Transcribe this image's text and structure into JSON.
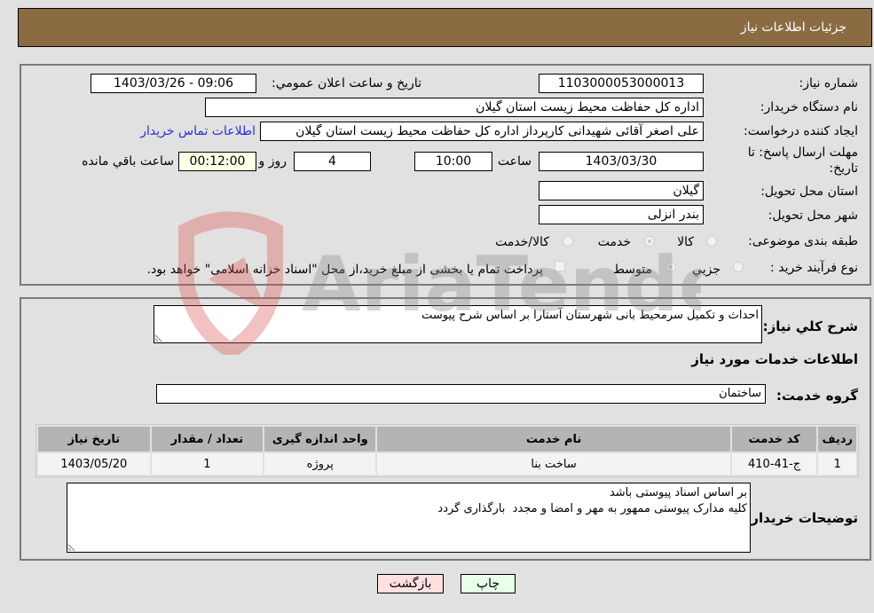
{
  "header": {
    "title": "جزئیات اطلاعات نیاز"
  },
  "details": {
    "need_number_label": "شماره نیاز:",
    "need_number": "1103000053000013",
    "announce_label": "تاريخ و ساعت اعلان عمومي:",
    "announce_value": "1403/03/26 - 09:06",
    "buyer_org_label": "نام دستگاه خریدار:",
    "buyer_org": "اداره کل حفاظت محیط زیست استان گیلان",
    "creator_label": "ایجاد کننده درخواست:",
    "creator": "علی اصغر آقائی شهیدانی کارپرداز اداره کل حفاظت محیط زیست استان گیلان",
    "contact_link": "اطلاعات تماس خریدار",
    "deadline_label_line1": "مهلت ارسال پاسخ: تا",
    "deadline_label_line2": "تاریخ:",
    "deadline_date": "1403/03/30",
    "time_label": "ساعت",
    "deadline_time": "10:00",
    "days_value": "4",
    "days_label": "روز و",
    "remaining_time": "00:12:00",
    "remaining_label": "ساعت باقي مانده",
    "province_label": "استان محل تحویل:",
    "province": "گیلان",
    "city_label": "شهر محل تحویل:",
    "city": "بندر انزلی",
    "category_label": "طبقه بندی موضوعی:",
    "category_options": [
      {
        "label": "کالا",
        "checked": false
      },
      {
        "label": "خدمت",
        "checked": true
      },
      {
        "label": "کالا/خدمت",
        "checked": false
      }
    ],
    "process_label": "نوع فرآیند خرید :",
    "process_options": [
      {
        "label": "جزیي",
        "checked": false
      },
      {
        "label": "متوسط",
        "checked": true
      }
    ],
    "treasury_checkbox_label": "پرداخت تمام یا بخشی از مبلغ خرید،از محل \"اسناد خزانه اسلامی\" خواهد بود.",
    "treasury_checked": false
  },
  "services": {
    "description_label": "شرح کلي نياز:",
    "description": "احداث و تکمیل سرمحیط بانی شهرستان آستارا بر اساس شرح پیوست",
    "section_title": "اطلاعات خدمات مورد نياز",
    "group_label": "گروه خدمت:",
    "group_value": "ساختمان",
    "table": {
      "headers": [
        "ردیف",
        "کد خدمت",
        "نام خدمت",
        "واحد اندازه گیری",
        "تعداد / مقدار",
        "تاریخ نیاز"
      ],
      "rows": [
        [
          "1",
          "ج-41-410",
          "ساخت بنا",
          "پروژه",
          "1",
          "1403/05/20"
        ]
      ]
    },
    "buyer_notes_label": "توضیحات خریدار:",
    "buyer_notes": "بر اساس اسناد پیوستی باشد\nکلیه مدارک پیوستی ممهور به مهر و امضا و مجدد  بارگذاری گردد"
  },
  "buttons": {
    "print": "چاپ",
    "back": "بازگشت"
  },
  "watermark": {
    "text": "AriaTender.neT"
  },
  "colors": {
    "header_bg": "#8b6c42",
    "print_btn_bg": "#eaffea",
    "back_btn_bg": "#ffe0e0",
    "link": "#2b2bd8"
  }
}
